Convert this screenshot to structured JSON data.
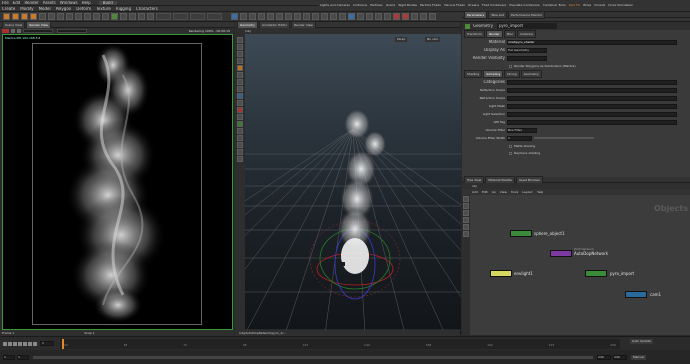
{
  "menu": {
    "items": [
      "File",
      "Edit",
      "Render",
      "Assets",
      "Windows",
      "Help"
    ],
    "build_label": "Build",
    "shelf_tabs": [
      "Create",
      "Modify",
      "Model",
      "Polygon",
      "Deform",
      "Texture",
      "Rigging",
      "Characters"
    ],
    "right_shelf_tabs": [
      "Lights and Cameras",
      "Collisions",
      "Particles",
      "Grains",
      "Rigid Bodies",
      "Particle Fluids",
      "Viscous Fluids",
      "Oceans",
      "Fluid Containers",
      "Populate Containers",
      "Container Tools",
      "Pyro FX",
      "Wires",
      "Crowds",
      "Drive Simulation"
    ]
  },
  "left_pane": {
    "tabs": [
      "Scene View",
      "Render View"
    ],
    "status": "Rendering 100% - 00:00:15",
    "info_line1": "Mantra IPR  192.168.5.8",
    "frame_label": "Frame 1",
    "snapshot_label": "Snap 1"
  },
  "center_pane": {
    "tabs": [
      "Geometry",
      "Animation Editor",
      "Render View"
    ],
    "path": "/obj",
    "view_label": "Persp",
    "cam_label": "No cam",
    "bottom_path": "/obj/AutoDopNetwork/pyro_1/..."
  },
  "params": {
    "tabs": [
      "Parameters",
      "Take List",
      "Performance Monitor"
    ],
    "node_type": "Geometry",
    "node_name": "pyro_import",
    "header_tabs": [
      "Transform",
      "Render",
      "Misc",
      "Instance"
    ],
    "fields": [
      {
        "label": "Material",
        "value": "/mat/pyro_shader"
      },
      {
        "label": "Display As",
        "value": "Full Geometry"
      },
      {
        "label": "Render Visibility",
        "value": ""
      }
    ],
    "checkbox_label": "Render Polygons As Subdivision (Mantra)",
    "sub_tabs": [
      "Shading",
      "Sampling",
      "Dicing",
      "Geometry"
    ],
    "section_label": "Categories",
    "list_labels": [
      "Reflection Scope",
      "Refraction Scope",
      "Light Mask",
      "Light Selection",
      "LPE Tag",
      "Volume Filter",
      "Volume Filter Width"
    ],
    "volume_filter_value": "Box Filter",
    "volume_filter_width": "1",
    "matte_label": "Matte shading",
    "phantom_label": "Raytrace shading"
  },
  "network": {
    "tabs": [
      "Tree View",
      "Material Palette",
      "Asset Browser"
    ],
    "path": "obj",
    "menu_items": [
      "Add",
      "Edit",
      "Go",
      "View",
      "Tools",
      "Layout",
      "Help"
    ],
    "context_label": "Objects",
    "nodes": [
      {
        "name": "sphere_object1",
        "sub": "",
        "color": "#3a8a3a"
      },
      {
        "name": "AutoDopNetwork",
        "sub": "DOP Network",
        "color": "#7a3aa0"
      },
      {
        "name": "envlight1",
        "sub": "",
        "color": "#e0e060"
      },
      {
        "name": "pyro_import",
        "sub": "",
        "color": "#3a8a3a"
      },
      {
        "name": "cam1",
        "sub": "",
        "color": "#2a6a9a"
      }
    ]
  },
  "timeline": {
    "current_frame": "1",
    "start_frame": "1",
    "end_frame": "240",
    "tick_labels": [
      "24",
      "48",
      "72",
      "96",
      "120",
      "144",
      "168",
      "192",
      "216",
      "240"
    ],
    "auto_update": "Auto Update",
    "mode_label": "Manual"
  },
  "colors": {
    "accent_orange": "#e08a2a",
    "render_border": "#3a9a3a",
    "network_bg": "#3c3c3c"
  }
}
